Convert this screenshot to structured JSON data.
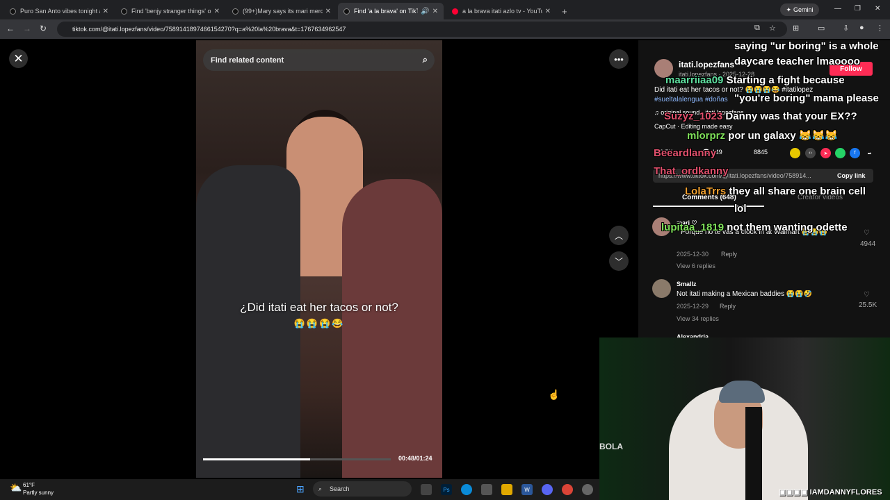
{
  "browser": {
    "tabs": [
      {
        "title": "Puro San Anto vibes tonight at",
        "color": "#222222"
      },
      {
        "title": "Find 'benjy stranger things' on",
        "color": "#222222"
      },
      {
        "title": "(99+)Mary says its mari merch",
        "color": "#222222"
      },
      {
        "title": "Find 'a la brava' on TikTok |",
        "color": "#222222"
      },
      {
        "title": "a la brava itati azlo tv - YouTube",
        "color": "#ff0033"
      }
    ],
    "gemini_label": "Gemini",
    "url": "tiktok.com/@itati.lopezfans/video/7589141897466154270?q=a%20la%20brava&t=1767634962547"
  },
  "video": {
    "search_placeholder": "Find related content",
    "caption": "¿Did itati eat her tacos or not?",
    "caption_emoji": "😭😭😭😂",
    "time": "00:48/01:24",
    "progress": 0.57
  },
  "post": {
    "author": "itati.lopezfans",
    "author_sub": "itati.lopezfans · 2025-12-28",
    "follow": "Follow",
    "description": "Did itati eat her tacos or not? 😭😭😭😂 #itatilopez",
    "hashtags": "#sueltalalengua #doñas",
    "sound": "♫  original sound - itati.lopezfans",
    "capcut": "CapCut · Editing made easy",
    "likes": "2.5K",
    "comments_count": "149",
    "saves": "8845",
    "link": "https://www.tiktok.com/@itati.lopezfans/video/758914...",
    "copy_link": "Copy link",
    "tab_comments": "Comments (648)",
    "tab_creator": "Creator videos"
  },
  "comments": [
    {
      "user": "mari ♡",
      "text": "Porque no te vas a clock in at Walmart 😭😭😭",
      "date": "2025-12-30",
      "reply": "Reply",
      "likes": "4944",
      "view_replies": "View 6 replies"
    },
    {
      "user": "Smallz",
      "text": "Not itati making a Mexican baddies 😭😭🤣",
      "date": "2025-12-29",
      "reply": "Reply",
      "likes": "25.5K",
      "view_replies": "View 34 replies"
    },
    {
      "user": "Alexandria"
    }
  ],
  "chat": [
    {
      "user": "",
      "text": "saying \"ur boring\" is a whole",
      "color": "#ffffff"
    },
    {
      "user": "",
      "text": "daycare teacher lmaoooo",
      "color": "#ffffff"
    },
    {
      "user": "maarriiaa09",
      "text": "Starting a fight because",
      "color": "#5fe0a0"
    },
    {
      "user": "",
      "text": "\"you're boring\" mama please",
      "color": "#ffffff"
    },
    {
      "user": "Suzyz_1023",
      "text": "Danny was that your EX??",
      "color": "#e0506c"
    },
    {
      "user": "mlorprz",
      "text": "por un galaxy 😹😹😹",
      "color": "#7fe05a"
    },
    {
      "user": "Beeardlanny",
      "text": "",
      "color": "#e0506c"
    },
    {
      "user": "That_ordkanny",
      "text": "",
      "color": "#e0506c"
    },
    {
      "user": "LolaTrrs",
      "text": "they all share one brain cell",
      "color": "#f0a030"
    },
    {
      "user": "",
      "text": "lol",
      "color": "#ffffff"
    },
    {
      "user": "lupitaa_1819",
      "text": "not them wanting odette",
      "color": "#7fe05a"
    }
  ],
  "stream": {
    "bola": "BOLA",
    "handle": "IAMDANNYFLORES"
  },
  "taskbar": {
    "temp": "61°F",
    "weather": "Partly sunny",
    "search": "Search"
  }
}
